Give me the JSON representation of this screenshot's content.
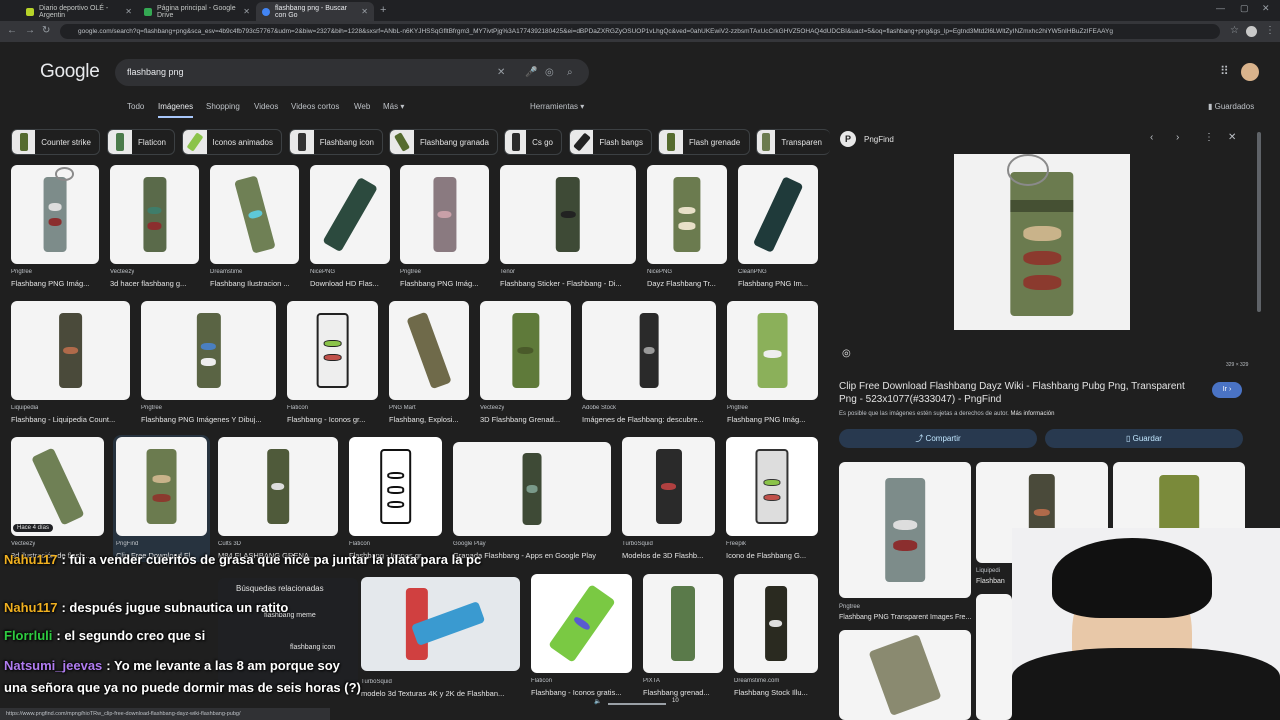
{
  "browser": {
    "tabs": [
      {
        "title": "Diario deportivo OLÉ - Argentin",
        "favcolor": "#b7d329",
        "active": false
      },
      {
        "title": "Página principal - Google Drive",
        "favcolor": "#34a853",
        "active": false
      },
      {
        "title": "flashbang png - Buscar con Go",
        "favcolor": "#4285f4",
        "active": true
      }
    ],
    "new_tab": "+",
    "url": "google.com/search?q=flashbang+png&sca_esv=4b9c4fb793c57767&udm=2&biw=2327&bih=1228&sxsrf=ANbL-n6KYJHSSqGfltBfrgm3_MY7ivtPjg%3A1774392180425&ei=dBPDaZXRGZyOSUOP1vLhgQc&ved=0ahUKEwiV2-zzbsmTAxUcCrkGHVZ5OHAQ4dUDCBI&uact=5&oq=flashbang+png&gs_lp=Egtnd3Mtd2l6LWltZyINZmxhc2hiYW5nIHBuZzIFEAAYg"
  },
  "header": {
    "logo": "Google",
    "query": "flashbang png",
    "nav_tabs": [
      "Todo",
      "Imágenes",
      "Shopping",
      "Videos",
      "Videos cortos",
      "Web",
      "Más ▾"
    ],
    "active_tab": "Imágenes",
    "tools": "Herramientas ▾",
    "saved": "Guardados"
  },
  "chips": [
    "Counter strike",
    "Flaticon",
    "Iconos animados",
    "Flashbang icon",
    "Flashbang granada",
    "Cs go",
    "Flash bangs",
    "Flash grenade",
    "Transparen"
  ],
  "results_row1": [
    {
      "src": "Pngtree",
      "title": "Flashbang PNG Imág..."
    },
    {
      "src": "Vecteezy",
      "title": "3d hacer flashbang g..."
    },
    {
      "src": "Dreamstime",
      "title": "Flashbang Ilustracion ..."
    },
    {
      "src": "NicePNG",
      "title": "Download HD Flas..."
    },
    {
      "src": "Pngtree",
      "title": "Flashbang PNG Imág..."
    },
    {
      "src": "Tenor",
      "title": "Flashbang Sticker - Flashbang - Di..."
    },
    {
      "src": "NicePNG",
      "title": "Dayz Flashbang Tr..."
    },
    {
      "src": "CleanPNG",
      "title": "Flashbang PNG Im..."
    }
  ],
  "results_row2": [
    {
      "src": "Liquipedia",
      "title": "Flashbang - Liquipedia Count..."
    },
    {
      "src": "Pngtree",
      "title": "Flashbang PNG Imágenes Y Dibuj..."
    },
    {
      "src": "Flaticon",
      "title": "Flashbang - Iconos gr..."
    },
    {
      "src": "PNG Mart",
      "title": "Flashbang, Explosi..."
    },
    {
      "src": "Vecteezy",
      "title": "3D Flashbang Grenad..."
    },
    {
      "src": "Adobe Stock",
      "title": "Imágenes de Flashbang: descubre..."
    },
    {
      "src": "Pngtree",
      "title": "Flashbang PNG Imág..."
    }
  ],
  "results_row3": [
    {
      "src": "Vecteezy",
      "title": "3d ilustración de flash...",
      "badge": "Hace 4 días"
    },
    {
      "src": "PngFind",
      "title": "Clip Free Download Fl..."
    },
    {
      "src": "Cults 3D",
      "title": "M84 FLASHBANG GRENA..."
    },
    {
      "src": "Flaticon",
      "title": "Flashbang - Iconos gr..."
    },
    {
      "src": "Google Play",
      "title": "Granada Flashbang - Apps en Google Play"
    },
    {
      "src": "TurboSquid",
      "title": "Modelos de 3D Flashb..."
    },
    {
      "src": "Freepik",
      "title": "Icono de Flashbang G..."
    }
  ],
  "results_row4": [
    {
      "src": "TurboSquid",
      "title": "modelo 3d Texturas 4K y 2K de Flashban..."
    },
    {
      "src": "Flaticon",
      "title": "Flashbang - Iconos gratis..."
    },
    {
      "src": "PIXTA",
      "title": "Flashbang grenad..."
    },
    {
      "src": "Dreamstime.com",
      "title": "Flashbang Stock Illu..."
    }
  ],
  "related": {
    "title": "Búsquedas relacionadas",
    "items": [
      "flashbang meme",
      "flashbang icon"
    ]
  },
  "panel": {
    "source": "PngFind",
    "dims": "329 × 329",
    "title": "Clip Free Download Flashbang Dayz Wiki - Flashbang Pubg Png, Transparent Png - 523x1077(#333047) - PngFind",
    "visit": "Ir ›",
    "copyright": "Es posible que las imágenes estén sujetas a derechos de autor.",
    "more_info": "Más información",
    "share": "Compartir",
    "save": "Guardar",
    "related": [
      {
        "src": "Pngtree",
        "title": "Flashbang PNG Transparent Images Fre..."
      },
      {
        "src": "Liquipedi",
        "title": "Flashban"
      }
    ]
  },
  "chat": [
    {
      "user": "Nahu117",
      "user_color": "#f0b020",
      "msg": ": fui a vender cueritos de grasa que nice pa juntar la plata para la pc"
    },
    {
      "user": "Nahu117",
      "user_color": "#f0b020",
      "msg": ": después jugue subnautica un ratito"
    },
    {
      "user": "Florrluli",
      "user_color": "#2ecc40",
      "msg": ": el segundo creo que si"
    },
    {
      "user": "Natsumi_jeevas",
      "user_color": "#b07cf0",
      "msg": ": Yo me levante a las 8 am porque soy una señora que ya no puede dormir mas de seis horas (?)"
    }
  ],
  "status_url": "https://www.pngfind.com/mpng/hioTRw_clip-free-download-flashbang-dayz-wiki-flashbang-pubg/",
  "volume": "10"
}
